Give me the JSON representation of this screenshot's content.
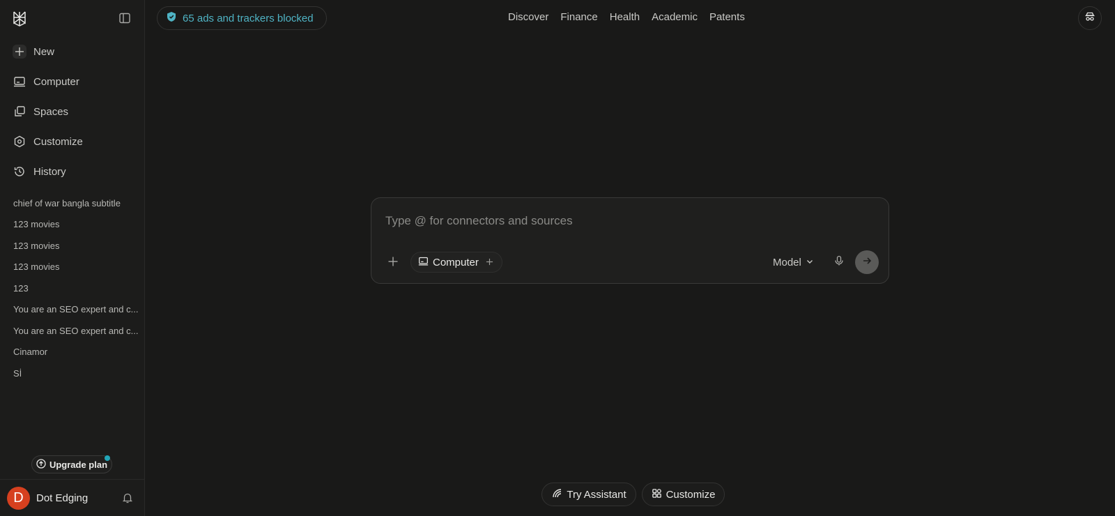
{
  "sidebar": {
    "nav": [
      {
        "label": "New",
        "icon": "plus-icon"
      },
      {
        "label": "Computer",
        "icon": "computer-icon"
      },
      {
        "label": "Spaces",
        "icon": "spaces-icon"
      },
      {
        "label": "Customize",
        "icon": "hexagon-icon"
      },
      {
        "label": "History",
        "icon": "history-icon"
      }
    ],
    "history": [
      "chief of war bangla subtitle",
      "123 movies",
      "123 movies",
      "123 movies",
      "123",
      "You are an SEO expert and c...",
      "You are an SEO expert and c...",
      "Cinamor",
      "Sİ"
    ],
    "upgrade_label": "Upgrade plan",
    "user": {
      "initial": "D",
      "name": "Dot Edging",
      "avatar_color": "#d6401f"
    }
  },
  "topbar": {
    "blocked_label": "65 ads and trackers blocked",
    "nav": [
      "Discover",
      "Finance",
      "Health",
      "Academic",
      "Patents"
    ]
  },
  "composer": {
    "placeholder": "Type @ for connectors and sources",
    "value": "",
    "chip_label": "Computer",
    "model_label": "Model"
  },
  "bottom": {
    "try_assistant": "Try Assistant",
    "customize": "Customize"
  },
  "colors": {
    "background": "#191918",
    "accent": "#4fb3c4",
    "notification_dot": "#22a6b8"
  }
}
